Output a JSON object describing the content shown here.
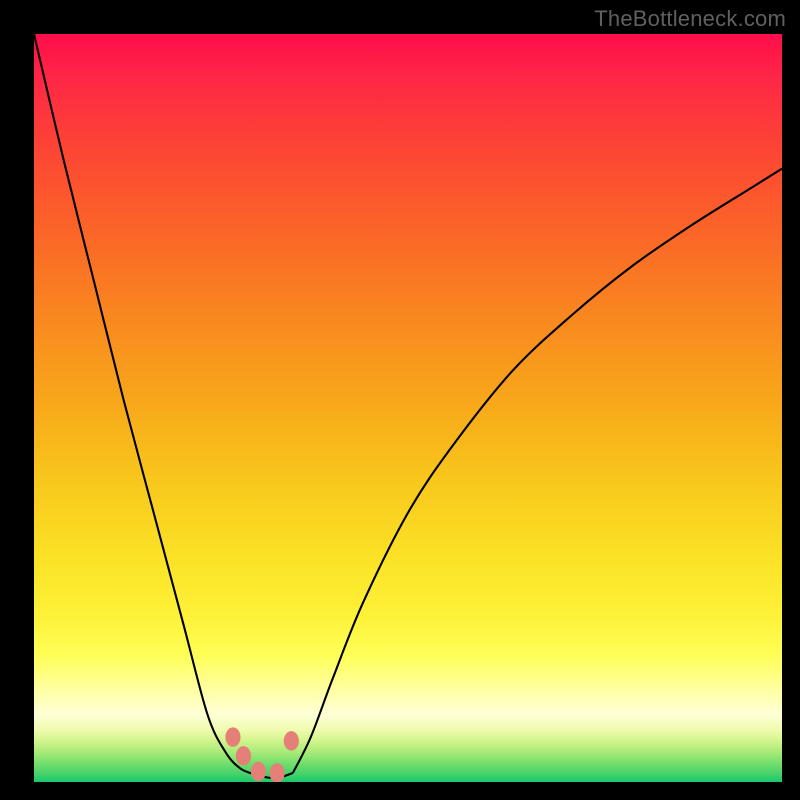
{
  "watermark": "TheBottleneck.com",
  "chart_data": {
    "type": "line",
    "title": "",
    "xlabel": "",
    "ylabel": "",
    "xlim": [
      0,
      1
    ],
    "ylim": [
      0,
      1
    ],
    "note": "Axes are unlabeled; values are normalized fractions of the plot extent as read from the image. Lower y (closer to 0) corresponds to the green band at the bottom.",
    "series": [
      {
        "name": "curve-left",
        "x": [
          0.0,
          0.04,
          0.08,
          0.12,
          0.16,
          0.2,
          0.232,
          0.256,
          0.276,
          0.296
        ],
        "y": [
          1.0,
          0.83,
          0.67,
          0.51,
          0.36,
          0.21,
          0.09,
          0.04,
          0.018,
          0.01
        ]
      },
      {
        "name": "trough",
        "x": [
          0.296,
          0.312,
          0.328,
          0.346
        ],
        "y": [
          0.01,
          0.006,
          0.006,
          0.012
        ]
      },
      {
        "name": "curve-right",
        "x": [
          0.346,
          0.37,
          0.4,
          0.44,
          0.5,
          0.56,
          0.64,
          0.72,
          0.8,
          0.88,
          0.96,
          1.0
        ],
        "y": [
          0.012,
          0.06,
          0.14,
          0.24,
          0.36,
          0.45,
          0.55,
          0.625,
          0.69,
          0.745,
          0.795,
          0.82
        ]
      }
    ],
    "markers": [
      {
        "name": "marker-left-1",
        "x": 0.266,
        "y": 0.06,
        "size": 0.026
      },
      {
        "name": "marker-left-2",
        "x": 0.28,
        "y": 0.035,
        "size": 0.026
      },
      {
        "name": "marker-mid-1",
        "x": 0.3,
        "y": 0.014,
        "size": 0.026
      },
      {
        "name": "marker-mid-2",
        "x": 0.325,
        "y": 0.012,
        "size": 0.026
      },
      {
        "name": "marker-right-1",
        "x": 0.344,
        "y": 0.055,
        "size": 0.026
      }
    ],
    "colors": {
      "curve": "#000000",
      "marker": "#e58079",
      "gradient_top": "#ff0d4a",
      "gradient_mid": "#f8c81c",
      "gradient_bottom": "#1ac86c",
      "frame": "#000000"
    }
  }
}
